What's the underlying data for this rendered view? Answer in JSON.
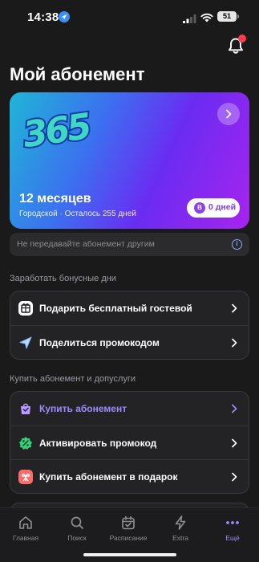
{
  "status_bar": {
    "time": "14:38",
    "battery": "51"
  },
  "header": {
    "title": "Мой абонемент"
  },
  "subscription": {
    "logo_text": "365",
    "period": "12 месяцев",
    "details": "Городской · Осталось 255 дней",
    "bonus_badge": "B",
    "bonus_days": "0 дней"
  },
  "notice": {
    "text": "Не передавайте абонемент другим",
    "icon_glyph": "i"
  },
  "bonus_section": {
    "title": "Заработать бонусные дни",
    "items": [
      {
        "label": "Подарить бесплатный гостевой",
        "icon": "gift-ticket-icon"
      },
      {
        "label": "Поделиться промокодом",
        "icon": "send-icon"
      }
    ]
  },
  "buy_section": {
    "title": "Купить абонемент и допуслуги",
    "items": [
      {
        "label": "Купить абонемент",
        "icon": "shopping-bag-icon"
      },
      {
        "label": "Активировать промокод",
        "icon": "percent-badge-icon"
      },
      {
        "label": "Купить абонемент в подарок",
        "icon": "gift-icon"
      }
    ]
  },
  "tabbar": {
    "tabs": [
      {
        "label": "Главная",
        "icon": "home-icon"
      },
      {
        "label": "Поиск",
        "icon": "search-icon"
      },
      {
        "label": "Расписание",
        "icon": "calendar-icon"
      },
      {
        "label": "Extra",
        "icon": "lightning-icon"
      },
      {
        "label": "Ещё",
        "icon": "more-dots-icon"
      }
    ],
    "active_index": 4
  },
  "colors": {
    "background": "#1a1a1a",
    "accent": "#9b8bff",
    "card_gradient": [
      "#1fb6d6",
      "#3c6ff0",
      "#6a2cf2",
      "#a724ee"
    ],
    "notification_dot": "#ff3b4f"
  }
}
